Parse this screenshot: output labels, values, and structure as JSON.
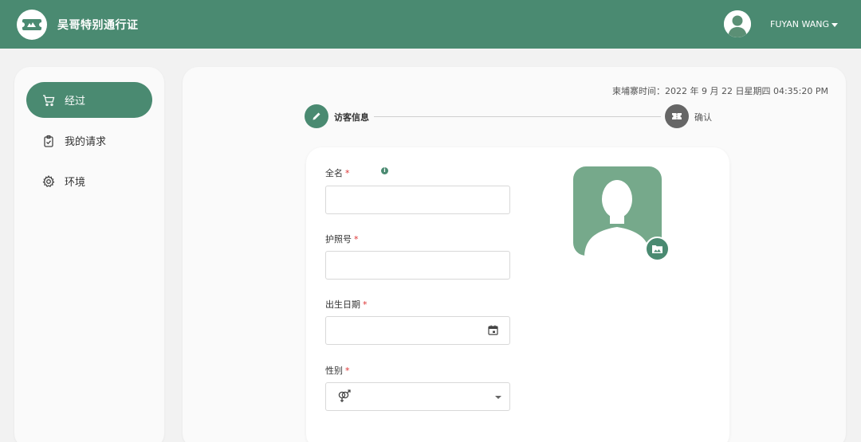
{
  "app": {
    "title": "吴哥特别通行证",
    "user_name": "FUYAN WANG"
  },
  "sidebar": {
    "items": [
      {
        "label": "经过",
        "icon": "cart-icon",
        "active": true
      },
      {
        "label": "我的请求",
        "icon": "clipboard-icon",
        "active": false
      },
      {
        "label": "环境",
        "icon": "gear-icon",
        "active": false
      }
    ]
  },
  "main": {
    "datetime": "柬埔寨时间：2022 年 9 月 22 日星期四 04:35:20 PM"
  },
  "steps": [
    {
      "label": "访客信息",
      "icon": "pencil-icon",
      "active": true
    },
    {
      "label": "确认",
      "icon": "ticket-icon",
      "active": false
    }
  ],
  "form": {
    "full_name": {
      "label": "全名",
      "required": "*",
      "value": ""
    },
    "passport": {
      "label": "护照号",
      "required": "*",
      "value": ""
    },
    "birth_date": {
      "label": "出生日期",
      "required": "*",
      "value": ""
    },
    "gender": {
      "label": "性别",
      "required": "*",
      "value": ""
    }
  },
  "colors": {
    "brand": "#4a8a71",
    "photo_bg": "#76a98b",
    "required": "#dd3333"
  }
}
